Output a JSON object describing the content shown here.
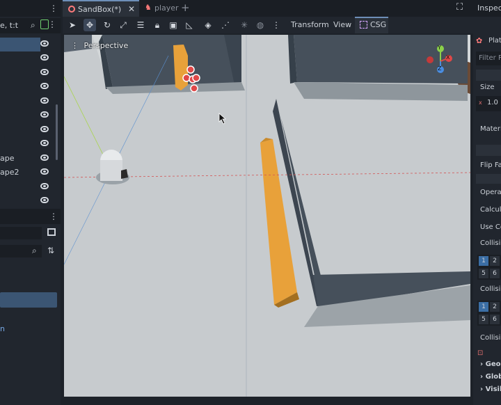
{
  "scene_tree": {
    "rows": [
      {
        "label": ""
      },
      {
        "label": ""
      },
      {
        "label": ""
      },
      {
        "label": ""
      },
      {
        "label": ""
      },
      {
        "label": ""
      },
      {
        "label": ""
      },
      {
        "label": ""
      },
      {
        "label": "ape"
      },
      {
        "label": "ape2"
      },
      {
        "label": ""
      },
      {
        "label": ""
      }
    ],
    "filter_text": "e, t:t"
  },
  "filesystem": {
    "item_text": "n"
  },
  "tabs": [
    {
      "label": "SandBox(*)",
      "active": true
    },
    {
      "label": "player",
      "active": false
    }
  ],
  "toolbar": {
    "menus": [
      "Transform",
      "View",
      "CSG"
    ]
  },
  "viewport": {
    "label": "Perspective",
    "gizmo": {
      "x": "X",
      "y": "Y",
      "z": "Z"
    }
  },
  "inspector": {
    "title": "Inspec",
    "node": "Plat",
    "filter": "Filter P",
    "size_label": "Size",
    "size_x_label": "x",
    "size_x_value": "1.0",
    "material_label": "Materi",
    "flip_faces_label": "Flip Fa",
    "operation_label": "Opera",
    "calc_label": "Calcula",
    "use_collision_label": "Use Co",
    "collision_layer_label": "Collisi",
    "collision_mask_label": "Collisi",
    "collision_priority_label": "Collisi",
    "layer_bits_top": [
      "1",
      "2"
    ],
    "layer_bits_bottom": [
      "5",
      "6"
    ],
    "sections": [
      "Geom",
      "Globa",
      "Visib"
    ]
  }
}
